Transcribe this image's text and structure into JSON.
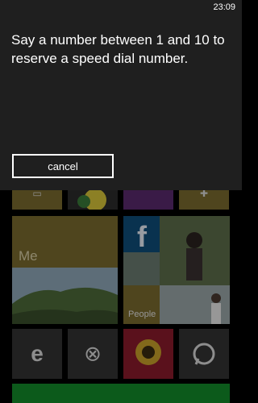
{
  "status_bar": {
    "time": "23:09"
  },
  "dialog": {
    "prompt": "Say a number between 1 and 10 to reserve a speed dial number.",
    "cancel_label": "cancel"
  },
  "tiles": {
    "me_label": "Me",
    "people_label": "People",
    "facebook_glyph": "f",
    "icons": [
      "calendar-icon",
      "settings-icon",
      "facebook-icon",
      "internet-explorer-icon",
      "xbox-icon",
      "music-icon",
      "whatsapp-icon"
    ]
  },
  "colors": {
    "dialog_bg": "#1f1f1f",
    "tile_gold": "#7a6a2e",
    "tile_blue": "#0f4d7a",
    "tile_red": "#8a1b2b",
    "tile_green": "#138a2a"
  }
}
